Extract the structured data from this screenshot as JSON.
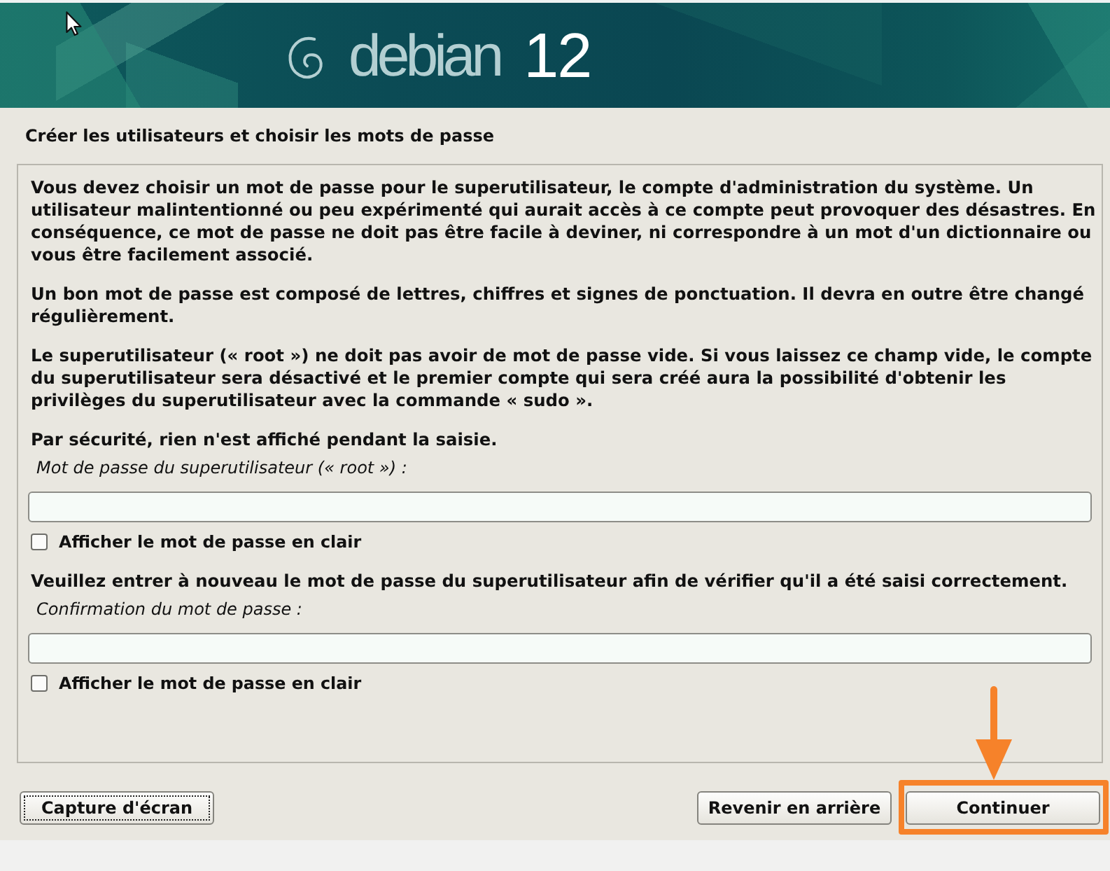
{
  "banner": {
    "brand": "debian",
    "version": "12"
  },
  "page_title": "Créer les utilisateurs et choisir les mots de passe",
  "form": [
    {
      "kind": "paragraph",
      "text": "Vous devez choisir un mot de passe pour le superutilisateur, le compte d'administration du système. Un utilisateur malintentionné ou peu expérimenté qui aurait accès à ce compte peut provoquer des désastres. En conséquence, ce mot de passe ne doit pas être facile à deviner, ni correspondre à un mot d'un dictionnaire ou vous être facilement associé."
    },
    {
      "kind": "paragraph",
      "text": "Un bon mot de passe est composé de lettres, chiffres et signes de ponctuation. Il devra en outre être changé régulièrement."
    },
    {
      "kind": "paragraph",
      "text": "Le superutilisateur (« root ») ne doit pas avoir de mot de passe vide. Si vous laissez ce champ vide, le compte du superutilisateur sera désactivé et le premier compte qui sera créé aura la possibilité d'obtenir les privilèges du superutilisateur avec la commande « sudo »."
    },
    {
      "kind": "paragraph",
      "text": "Par sécurité, rien n'est affiché pendant la saisie."
    },
    {
      "kind": "password_field",
      "label": "Mot de passe du superutilisateur (« root ») :"
    },
    {
      "kind": "checkbox",
      "label": "Afficher le mot de passe en clair",
      "checked": false
    },
    {
      "kind": "paragraph",
      "text": "Veuillez entrer à nouveau le mot de passe du superutilisateur afin de vérifier qu'il a été saisi correctement."
    },
    {
      "kind": "password_field",
      "label": "Confirmation du mot de passe :"
    },
    {
      "kind": "checkbox",
      "label": "Afficher le mot de passe en clair",
      "checked": false
    }
  ],
  "footer": {
    "left_buttons": [
      {
        "label": "Capture d'écran",
        "focused": true,
        "annotated": false
      }
    ],
    "right_buttons": [
      {
        "label": "Revenir en arrière",
        "focused": false,
        "annotated": false
      },
      {
        "label": "Continuer",
        "focused": false,
        "annotated": true
      }
    ]
  }
}
